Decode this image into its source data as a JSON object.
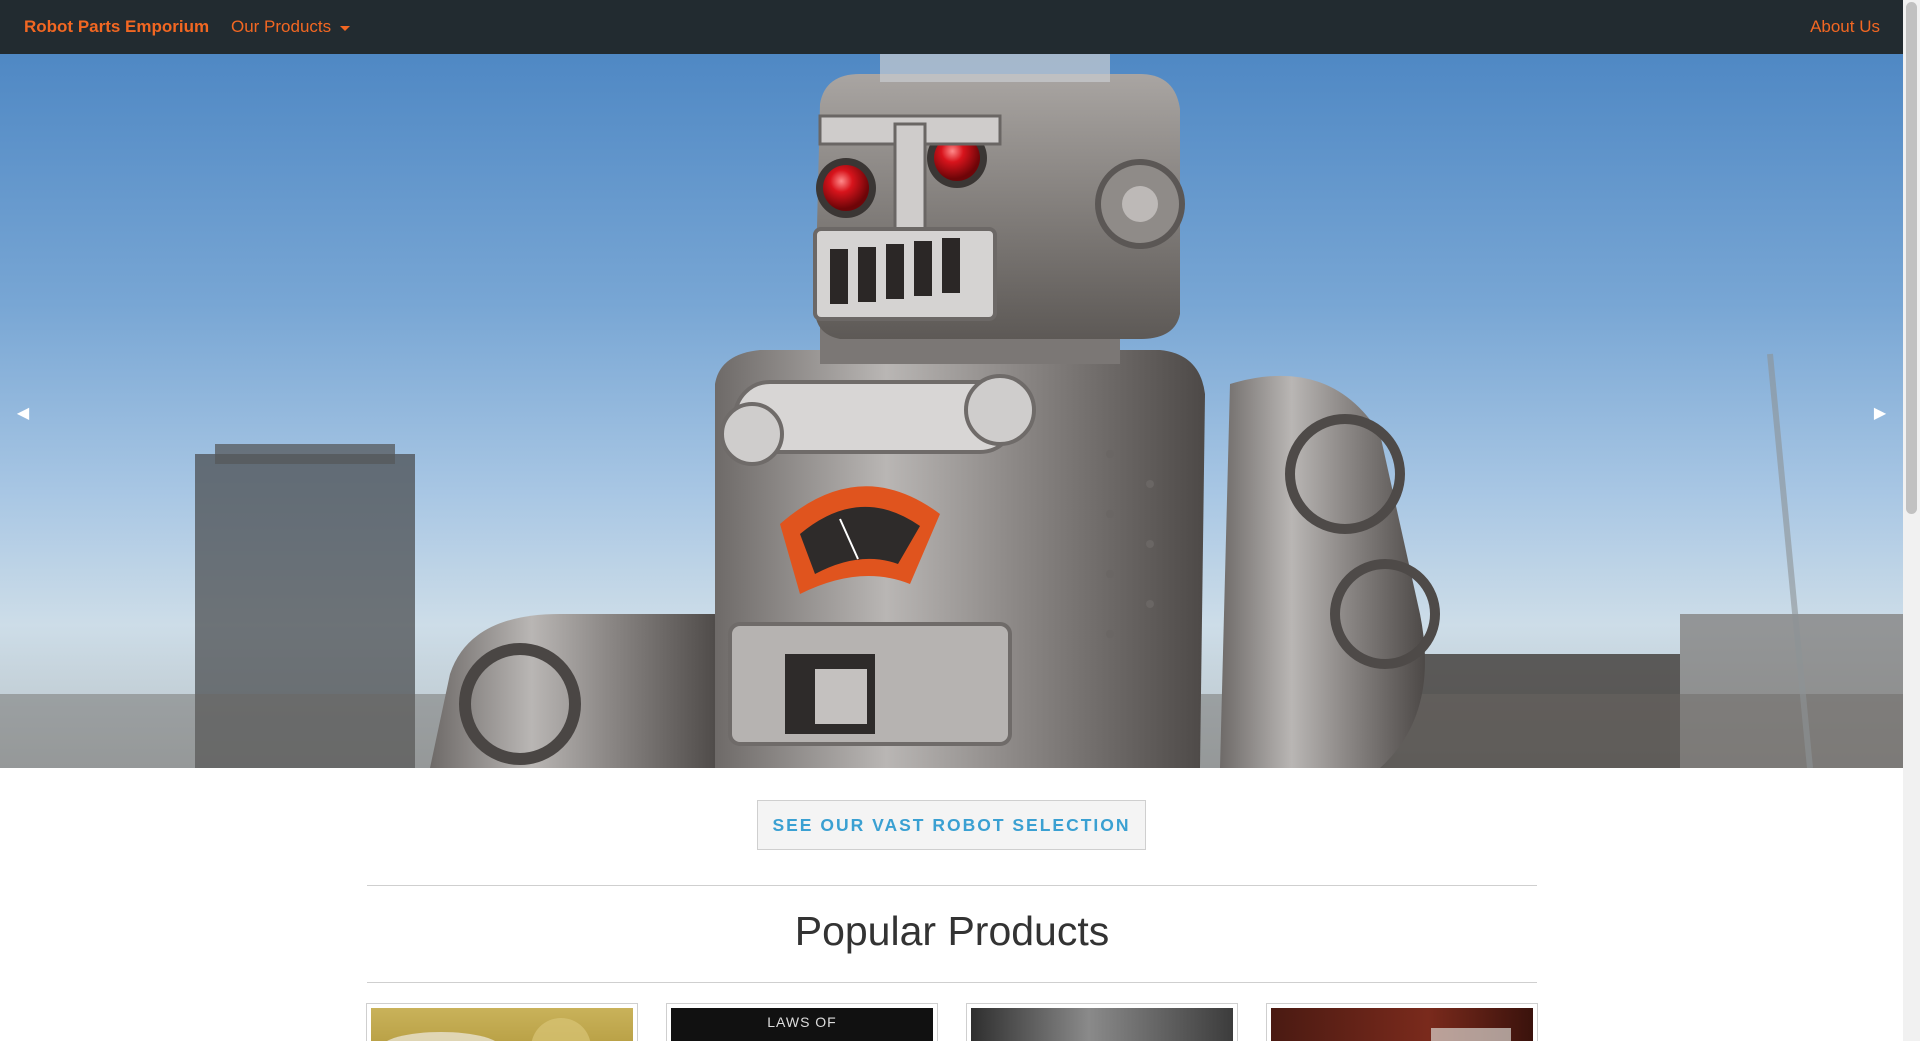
{
  "navbar": {
    "brand": "Robot Parts Emporium",
    "products_label": "Our Products",
    "about_label": "About Us",
    "accent_color": "#f26722",
    "background_color": "#222b30"
  },
  "hero": {
    "prev_icon": "◀",
    "next_icon": "▶"
  },
  "cta": {
    "label": "SEE OUR VAST ROBOT SELECTION",
    "color": "#3aa0d2"
  },
  "popular": {
    "title": "Popular Products",
    "products": [
      {
        "caption": ""
      },
      {
        "caption": "LAWS OF"
      },
      {
        "caption": ""
      },
      {
        "caption": ""
      }
    ]
  }
}
